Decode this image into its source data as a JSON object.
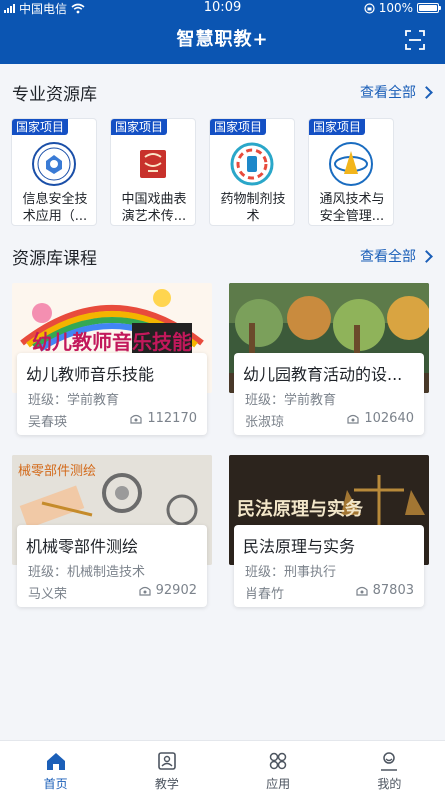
{
  "status_bar": {
    "carrier": "中国电信",
    "time": "10:09",
    "battery": "100%"
  },
  "header": {
    "title": "智慧职教+"
  },
  "libraries_section": {
    "title": "专业资源库",
    "more_label": "查看全部",
    "items": [
      {
        "tag": "国家项目",
        "name": "信息安全技术应用（..."
      },
      {
        "tag": "国家项目",
        "name": "中国戏曲表演艺术传..."
      },
      {
        "tag": "国家项目",
        "name": "药物制剂技术"
      },
      {
        "tag": "国家项目",
        "name": "通风技术与安全管理..."
      }
    ]
  },
  "courses_section": {
    "title": "资源库课程",
    "more_label": "查看全部",
    "items": [
      {
        "image_text": "幼儿教师音乐技能",
        "name": "幼儿教师音乐技能",
        "class": "班级：学前教育",
        "teacher": "吴春瑛",
        "views": "112170"
      },
      {
        "image_text": "",
        "name": "幼儿园教育活动的设...",
        "class": "班级：学前教育",
        "teacher": "张淑琼",
        "views": "102640"
      },
      {
        "image_text": "械零部件测绘",
        "name": "机械零部件测绘",
        "class": "班级：机械制造技术",
        "teacher": "马义荣",
        "views": "92902"
      },
      {
        "image_text": "民法原理与实务",
        "name": "民法原理与实务",
        "class": "班级：刑事执行",
        "teacher": "肖春竹",
        "views": "87803"
      }
    ]
  },
  "tabbar": {
    "items": [
      {
        "label": "首页",
        "icon": "home-icon",
        "active": true
      },
      {
        "label": "教学",
        "icon": "teach-icon",
        "active": false
      },
      {
        "label": "应用",
        "icon": "apps-icon",
        "active": false
      },
      {
        "label": "我的",
        "icon": "profile-icon",
        "active": false
      }
    ]
  },
  "colors": {
    "brand": "#0b55b2",
    "tag": "#1450c4",
    "link": "#1b5fb8"
  }
}
